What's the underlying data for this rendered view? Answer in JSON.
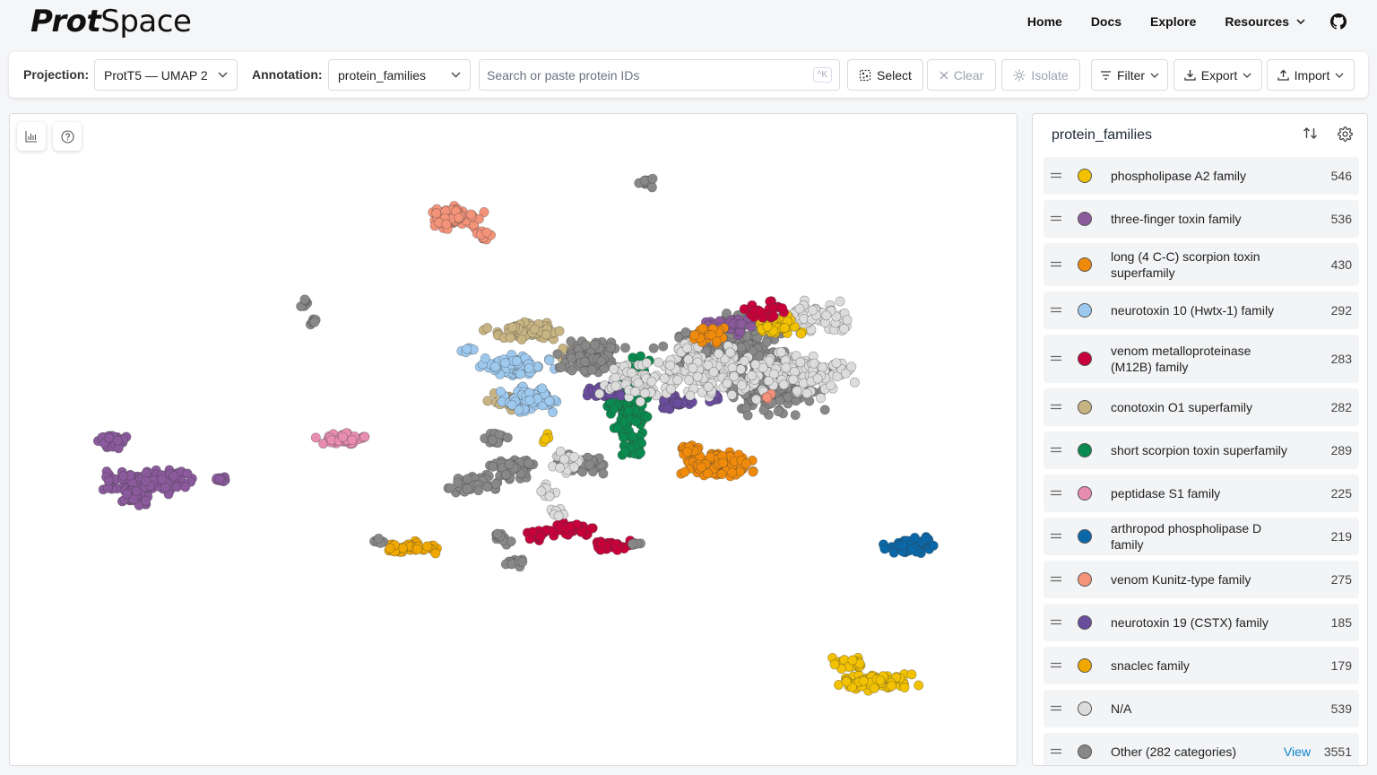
{
  "app": {
    "logo_bold": "Prot",
    "logo_thin": "Space"
  },
  "nav": {
    "home": "Home",
    "docs": "Docs",
    "explore": "Explore",
    "resources": "Resources",
    "github_icon": "github-icon"
  },
  "toolbar": {
    "projection_label": "Projection:",
    "projection_value": "ProtT5 — UMAP 2",
    "annotation_label": "Annotation:",
    "annotation_value": "protein_families",
    "search_placeholder": "Search or paste protein IDs",
    "search_shortcut": "^K",
    "select_label": "Select",
    "clear_label": "Clear",
    "isolate_label": "Isolate",
    "filter_label": "Filter",
    "export_label": "Export",
    "import_label": "Import"
  },
  "legend": {
    "title": "protein_families",
    "items": [
      {
        "label": "phospholipase A2 family",
        "count": "546",
        "color": "#f2c100"
      },
      {
        "label": "three-finger toxin family",
        "count": "536",
        "color": "#8a5a9c"
      },
      {
        "label": "long (4 C-C) scorpion toxin superfamily",
        "count": "430",
        "color": "#f08a0a"
      },
      {
        "label": "neurotoxin 10 (Hwtx-1) family",
        "count": "292",
        "color": "#9ec9ef"
      },
      {
        "label": "venom metalloproteinase (M12B) family",
        "count": "283",
        "color": "#c8003a"
      },
      {
        "label": "conotoxin O1 superfamily",
        "count": "282",
        "color": "#c7b482"
      },
      {
        "label": "short scorpion toxin superfamily",
        "count": "289",
        "color": "#0a8a4e"
      },
      {
        "label": "peptidase S1 family",
        "count": "225",
        "color": "#e88db0"
      },
      {
        "label": "arthropod phospholipase D family",
        "count": "219",
        "color": "#0a68a8"
      },
      {
        "label": "venom Kunitz-type family",
        "count": "275",
        "color": "#f4937a"
      },
      {
        "label": "neurotoxin 19 (CSTX) family",
        "count": "185",
        "color": "#6a4c9c"
      },
      {
        "label": "snaclec family",
        "count": "179",
        "color": "#f0a800"
      },
      {
        "label": "N/A",
        "count": "539",
        "color": "#dcdcdc"
      },
      {
        "label": "Other (282 categories)",
        "count": "3551",
        "color": "#888888",
        "view": "View"
      }
    ]
  }
}
